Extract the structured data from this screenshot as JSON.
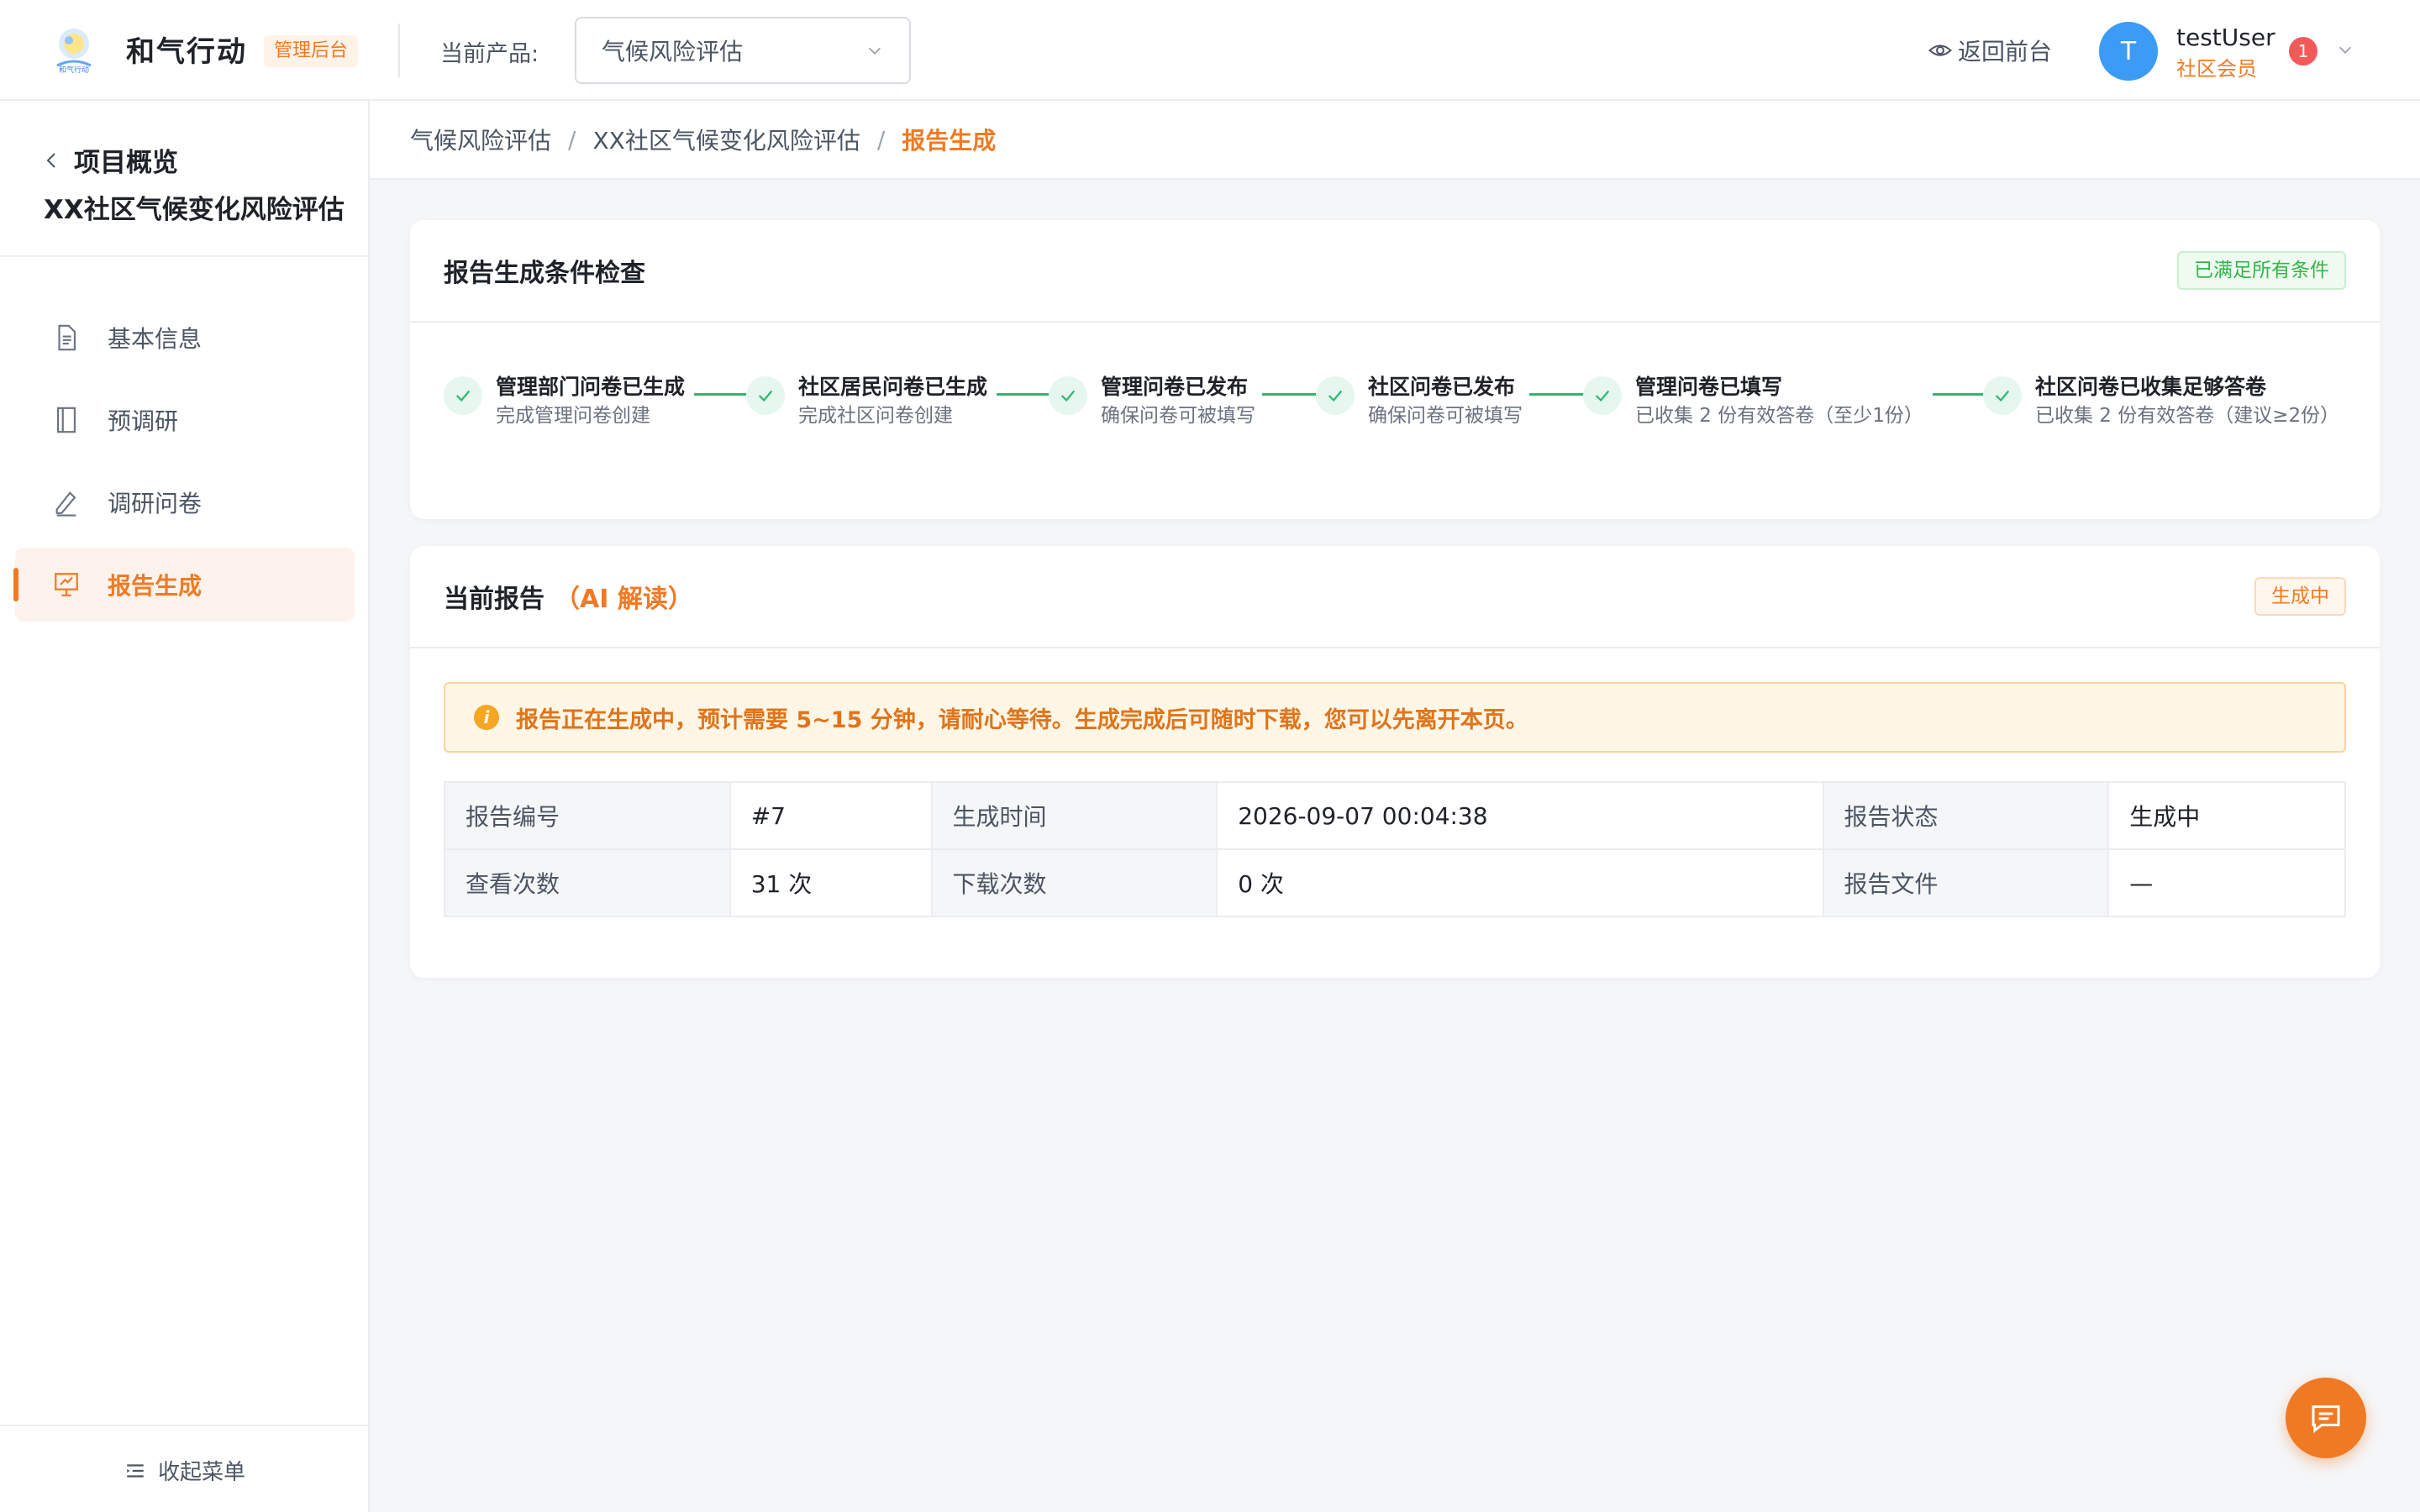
{
  "header": {
    "app_name": "和气行动",
    "admin_tag": "管理后台",
    "product_label": "当前产品:",
    "product_selected": "气候风险评估",
    "back_front_label": "返回前台",
    "user": {
      "avatar_initial": "T",
      "name": "testUser",
      "role": "社区会员",
      "notification_count": "1"
    }
  },
  "sidebar": {
    "back_label": "项目概览",
    "project_name": "XX社区气候变化风险评估",
    "items": [
      {
        "label": "基本信息",
        "icon": "document-icon",
        "active": false
      },
      {
        "label": "预调研",
        "icon": "notebook-icon",
        "active": false
      },
      {
        "label": "调研问卷",
        "icon": "pen-icon",
        "active": false
      },
      {
        "label": "报告生成",
        "icon": "presentation-icon",
        "active": true
      }
    ],
    "collapse_label": "收起菜单"
  },
  "breadcrumb": [
    "气候风险评估",
    "XX社区气候变化风险评估",
    "报告生成"
  ],
  "condition_card": {
    "title": "报告生成条件检查",
    "status_tag": "已满足所有条件",
    "steps": [
      {
        "title": "管理部门问卷已生成",
        "desc": "完成管理问卷创建"
      },
      {
        "title": "社区居民问卷已生成",
        "desc": "完成社区问卷创建"
      },
      {
        "title": "管理问卷已发布",
        "desc": "确保问卷可被填写"
      },
      {
        "title": "社区问卷已发布",
        "desc": "确保问卷可被填写"
      },
      {
        "title": "管理问卷已填写",
        "desc": "已收集 2 份有效答卷（至少1份）"
      },
      {
        "title": "社区问卷已收集足够答卷",
        "desc": "已收集 2 份有效答卷（建议≥2份）"
      }
    ]
  },
  "report_card": {
    "title": "当前报告",
    "title_accent": "（AI 解读）",
    "status_tag": "生成中",
    "alert": "报告正在生成中，预计需要 5~15 分钟，请耐心等待。生成完成后可随时下载，您可以先离开本页。",
    "table": {
      "row1": [
        {
          "label": "报告编号",
          "value": "#7"
        },
        {
          "label": "生成时间",
          "value": "2026-09-07 00:04:38"
        },
        {
          "label": "报告状态",
          "value": "生成中"
        }
      ],
      "row2": [
        {
          "label": "查看次数",
          "value": "31 次"
        },
        {
          "label": "下载次数",
          "value": "0 次"
        },
        {
          "label": "报告文件",
          "value": "—"
        }
      ]
    }
  },
  "colors": {
    "accent": "#f07a24",
    "success": "#2eb872",
    "avatar": "#3b9bf5",
    "badge": "#f25a5a"
  },
  "fab_icon": "chat-icon"
}
